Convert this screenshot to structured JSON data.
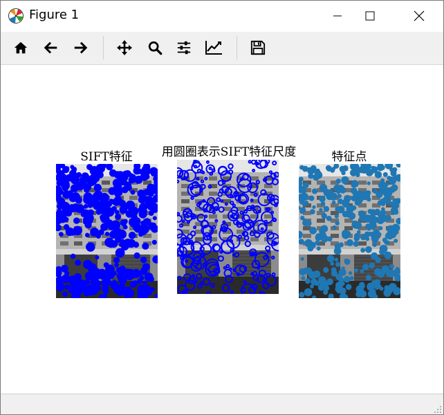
{
  "window": {
    "title": "Figure 1",
    "controls": {
      "minimize": "minimize",
      "maximize": "maximize",
      "close": "close"
    }
  },
  "toolbar": {
    "buttons": [
      {
        "name": "home",
        "icon": "home-icon",
        "tooltip": "Reset original view"
      },
      {
        "name": "back",
        "icon": "arrow-left-icon",
        "tooltip": "Back to previous view"
      },
      {
        "name": "forward",
        "icon": "arrow-right-icon",
        "tooltip": "Forward to next view"
      },
      {
        "name": "pan",
        "icon": "move-icon",
        "tooltip": "Pan axes"
      },
      {
        "name": "zoom",
        "icon": "magnifier-icon",
        "tooltip": "Zoom to rectangle"
      },
      {
        "name": "subplots",
        "icon": "sliders-icon",
        "tooltip": "Configure subplots"
      },
      {
        "name": "customize",
        "icon": "line-chart-icon",
        "tooltip": "Edit axis, curve and image parameters"
      },
      {
        "name": "save",
        "icon": "floppy-disk-icon",
        "tooltip": "Save the figure"
      }
    ]
  },
  "figure": {
    "subplots": [
      {
        "title": "SIFT特征",
        "marker_color": "#0000ff",
        "style": "filled-dots"
      },
      {
        "title": "用圆圈表示SIFT特征尺度",
        "marker_color": "#0000ff",
        "style": "scale-circles"
      },
      {
        "title": "特征点",
        "marker_color": "#1f77b4",
        "style": "filled-dots"
      }
    ]
  },
  "statusbar": {
    "text": ""
  }
}
